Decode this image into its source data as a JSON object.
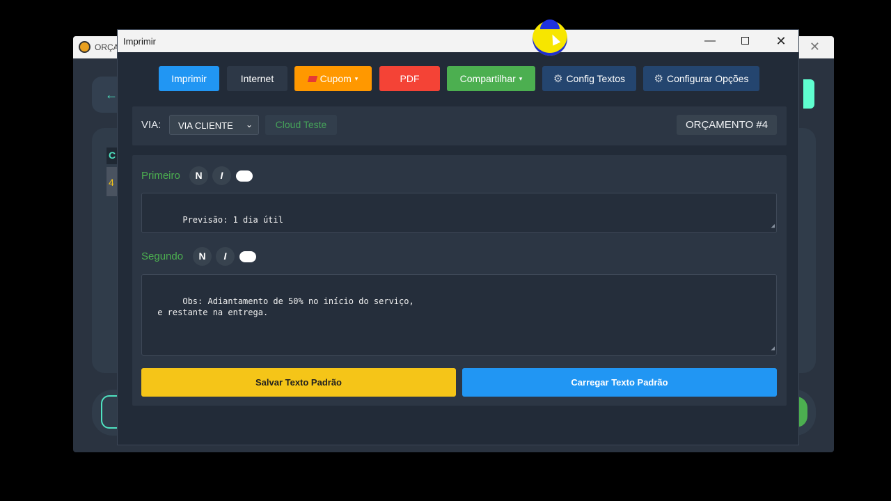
{
  "background_window": {
    "title": "ORÇA",
    "close_glyph": "✕",
    "back_arrow": "←",
    "column_letter": "C",
    "cell_digit": "4"
  },
  "dialog": {
    "title": "Imprimir",
    "min_glyph": "—",
    "close_glyph": "✕"
  },
  "toolbar": {
    "imprimir": "Imprimir",
    "internet": "Internet",
    "cupom": "Cupom",
    "pdf": "PDF",
    "compartilhar": "Compartilhar",
    "config_textos": "Config Textos",
    "configurar_opcoes": "Configurar Opções",
    "caret": "▾",
    "gear": "⚙"
  },
  "via": {
    "label": "VIA:",
    "selected": "VIA CLIENTE",
    "chevron": "⌄",
    "cloud": "Cloud Teste",
    "orcamento": "ORÇAMENTO #4"
  },
  "primeiro": {
    "label": "Primeiro",
    "bold": "N",
    "italic": "I",
    "text": "Previsão: 1 dia útil"
  },
  "segundo": {
    "label": "Segundo",
    "bold": "N",
    "italic": "I",
    "text": "Obs: Adiantamento de 50% no início do serviço,\n e restante na entrega."
  },
  "actions": {
    "save": "Salvar Texto Padrão",
    "load": "Carregar Texto Padrão"
  },
  "resize_grip": "◢"
}
